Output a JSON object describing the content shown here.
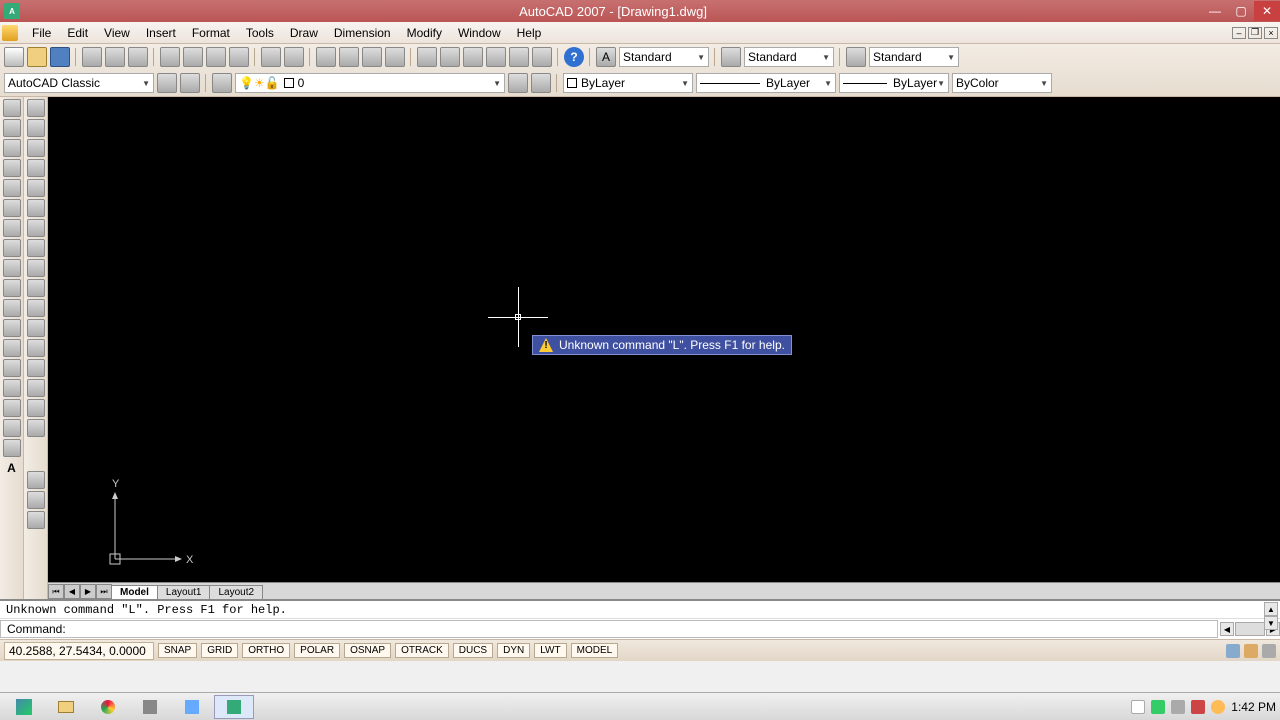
{
  "window": {
    "title": "AutoCAD 2007 - [Drawing1.dwg]",
    "logo_text": "A"
  },
  "menu": [
    "File",
    "Edit",
    "View",
    "Insert",
    "Format",
    "Tools",
    "Draw",
    "Dimension",
    "Modify",
    "Window",
    "Help"
  ],
  "workspace": "AutoCAD Classic",
  "styles": {
    "text_style": "Standard",
    "dim_style": "Standard",
    "table_style": "Standard"
  },
  "layer": {
    "current": "0",
    "color": "ByLayer",
    "linetype": "ByLayer",
    "lineweight": "ByLayer",
    "plotstyle": "ByColor"
  },
  "tooltip_text": "Unknown command \"L\".  Press F1 for help.",
  "ucs": {
    "x_label": "X",
    "y_label": "Y"
  },
  "layout_tabs": {
    "active": "Model",
    "tabs": [
      "Model",
      "Layout1",
      "Layout2"
    ]
  },
  "command": {
    "history": "Unknown command \"L\".  Press F1 for help.",
    "prompt": "Command:",
    "input": ""
  },
  "status": {
    "coords": "40.2588, 27.5434, 0.0000",
    "toggles": [
      "SNAP",
      "GRID",
      "ORTHO",
      "POLAR",
      "OSNAP",
      "OTRACK",
      "DUCS",
      "DYN",
      "LWT",
      "MODEL"
    ]
  },
  "clock": "1:42 PM",
  "colors": {
    "accent": "#bb5555",
    "canvas": "#000000",
    "tooltip": "#4050a0"
  }
}
